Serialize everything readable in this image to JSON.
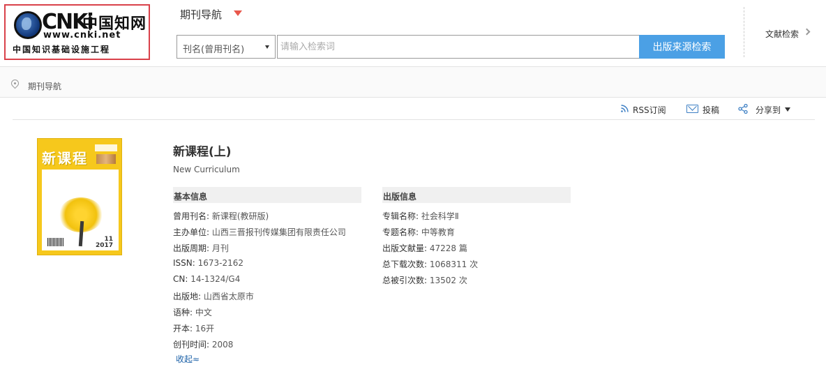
{
  "logo": {
    "brand": "CNKi",
    "brand_cn": "中国知网",
    "url": "www.cnki.net",
    "slogan": "中国知识基础设施工程"
  },
  "header": {
    "nav_title": "期刊导航",
    "search_field": "刊名(曾用刊名)",
    "search_placeholder": "请输入检索词",
    "search_button": "出版来源检索",
    "doc_search": "文献检索"
  },
  "breadcrumb": {
    "current": "期刊导航"
  },
  "actions": {
    "rss": "RSS订阅",
    "submit": "投稿",
    "share": "分享到"
  },
  "cover": {
    "title": "新课程",
    "issue_no": "11",
    "year": "2017"
  },
  "journal": {
    "title": "新课程(上)",
    "english": "New Curriculum"
  },
  "basic_info": {
    "heading": "基本信息",
    "items": [
      {
        "label": "曾用刊名:",
        "value": "新课程(教研版)"
      },
      {
        "label": "主办单位:",
        "value": "山西三晋报刊传媒集团有限责任公司"
      },
      {
        "label": "出版周期:",
        "value": "月刊"
      },
      {
        "label": "ISSN:",
        "value": "1673-2162"
      },
      {
        "label": "CN:",
        "value": "14-1324/G4"
      },
      {
        "label": "出版地:",
        "value": "山西省太原市"
      },
      {
        "label": "语种:",
        "value": "中文"
      },
      {
        "label": "开本:",
        "value": "16开"
      },
      {
        "label": "创刊时间:",
        "value": "2008"
      }
    ]
  },
  "pub_info": {
    "heading": "出版信息",
    "items": [
      {
        "label": "专辑名称:",
        "value": "社会科学Ⅱ"
      },
      {
        "label": "专题名称:",
        "value": "中等教育"
      },
      {
        "label": "出版文献量:",
        "value": "47228 篇"
      },
      {
        "label": "总下载次数:",
        "value": "1068311 次"
      },
      {
        "label": "总被引次数:",
        "value": "13502 次"
      }
    ]
  },
  "collapse_label": "收起≈",
  "colors": {
    "accent": "#4ba0e5",
    "caret": "#e8574b",
    "logo_border": "#d9414a",
    "link": "#1d62a8"
  }
}
